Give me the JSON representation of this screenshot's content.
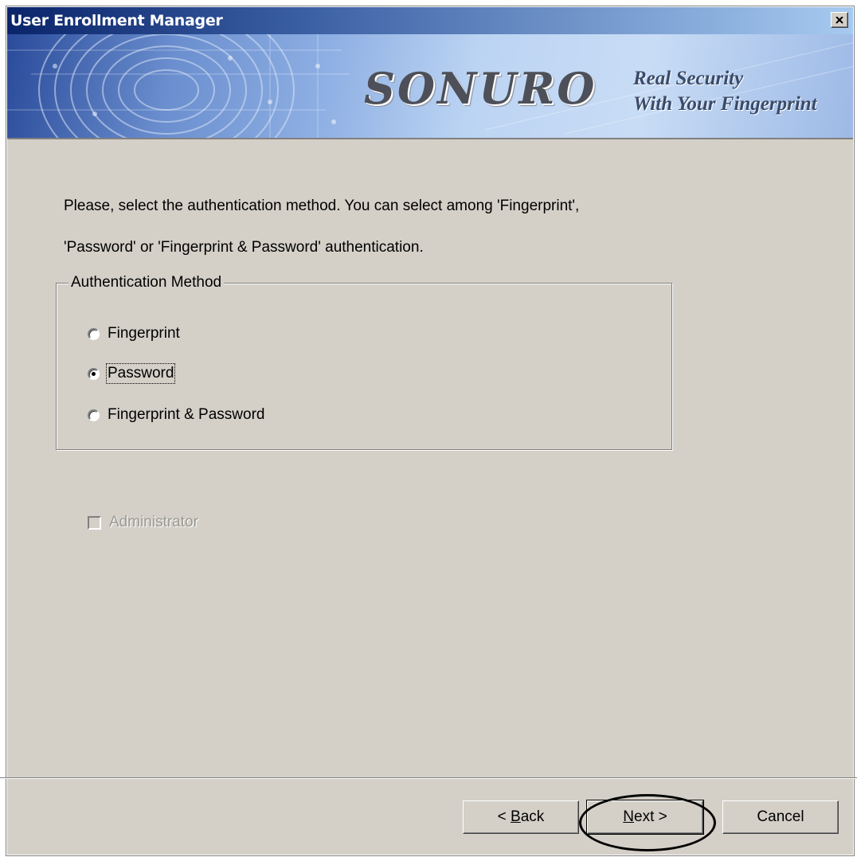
{
  "window": {
    "title": "User Enrollment Manager"
  },
  "banner": {
    "logo": "SONURO",
    "tagline_line1": "Real Security",
    "tagline_line2": "With Your Fingerprint"
  },
  "instructions": {
    "line1": "Please, select the authentication method. You can select among 'Fingerprint',",
    "line2": "'Password' or 'Fingerprint & Password' authentication."
  },
  "auth_group": {
    "legend": "Authentication Method",
    "options": [
      {
        "label": "Fingerprint",
        "checked": false
      },
      {
        "label": "Password",
        "checked": true
      },
      {
        "label": "Fingerprint & Password",
        "checked": false
      }
    ]
  },
  "administrator": {
    "label": "Administrator",
    "checked": false,
    "enabled": false
  },
  "buttons": {
    "back_prefix": "< ",
    "back_mnemonic": "B",
    "back_rest": "ack",
    "next_mnemonic": "N",
    "next_rest": "ext >",
    "cancel": "Cancel"
  },
  "colors": {
    "dialog_bg": "#d4d0c8",
    "titlebar_start": "#0a246a",
    "titlebar_end": "#a6caf0"
  }
}
